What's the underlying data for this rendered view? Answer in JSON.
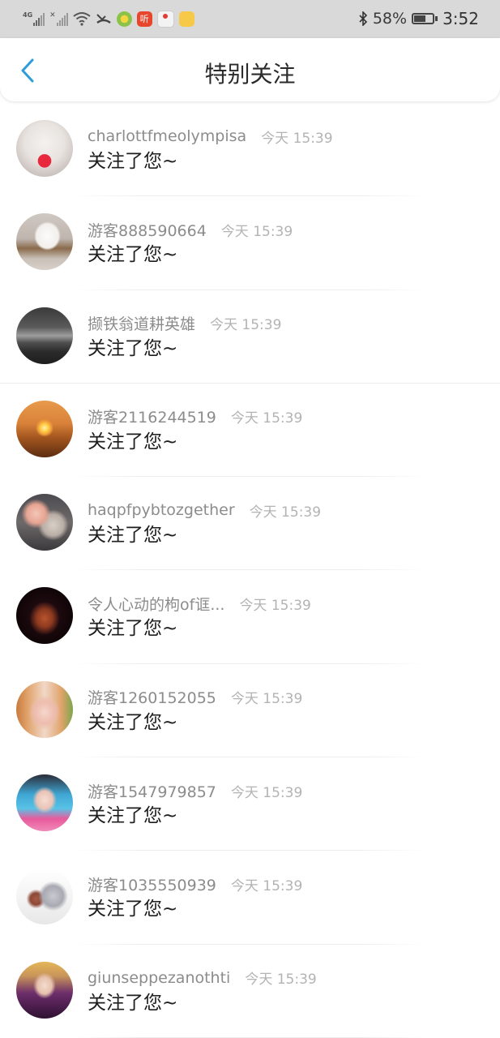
{
  "status_bar": {
    "network": "4G",
    "battery": "58%",
    "time": "3:52"
  },
  "header": {
    "title": "特别关注"
  },
  "items": [
    {
      "name": "charlottfmeolympisa",
      "time": "今天 15:39",
      "message": "关注了您~"
    },
    {
      "name": "游客888590664",
      "time": "今天 15:39",
      "message": "关注了您~"
    },
    {
      "name": "撷铁翁道耕英雄",
      "time": "今天 15:39",
      "message": "关注了您~"
    },
    {
      "name": "游客2116244519",
      "time": "今天 15:39",
      "message": "关注了您~"
    },
    {
      "name": "haqpfpybtozgether",
      "time": "今天 15:39",
      "message": "关注了您~"
    },
    {
      "name": "令人心动的枸of诓...",
      "time": "今天 15:39",
      "message": "关注了您~"
    },
    {
      "name": "游客1260152055",
      "time": "今天 15:39",
      "message": "关注了您~"
    },
    {
      "name": "游客1547979857",
      "time": "今天 15:39",
      "message": "关注了您~"
    },
    {
      "name": "游客1035550939",
      "time": "今天 15:39",
      "message": "关注了您~"
    },
    {
      "name": "giunseppezanothti",
      "time": "今天 15:39",
      "message": "关注了您~"
    }
  ]
}
